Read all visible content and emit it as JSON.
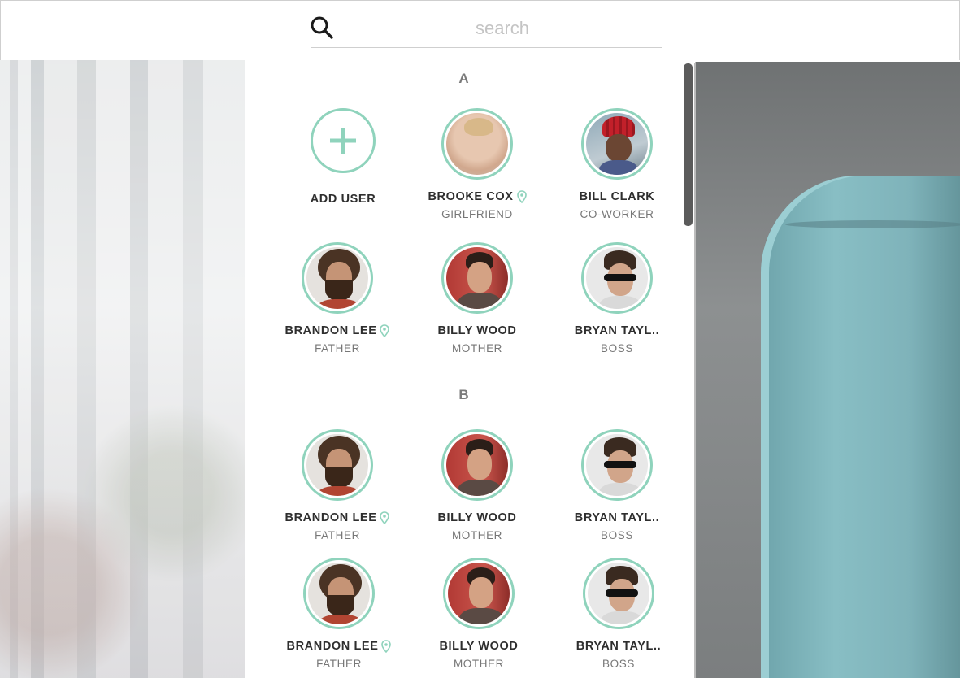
{
  "search": {
    "placeholder": "search"
  },
  "sections": [
    {
      "letter": "A"
    },
    {
      "letter": "B"
    }
  ],
  "add_user": {
    "label": "ADD USER"
  },
  "contacts": {
    "a1": {
      "name": "BROOKE COX",
      "relation": "GIRLFRIEND",
      "has_location": true,
      "avatar": "brooke"
    },
    "a2": {
      "name": "BILL CLARK",
      "relation": "CO-WORKER",
      "has_location": false,
      "avatar": "bill"
    },
    "a3": {
      "name": "BRANDON LEE",
      "relation": "FATHER",
      "has_location": true,
      "avatar": "brandon"
    },
    "a4": {
      "name": "BILLY WOOD",
      "relation": "MOTHER",
      "has_location": false,
      "avatar": "billy"
    },
    "a5": {
      "name": "BRYAN TAYL..",
      "relation": "BOSS",
      "has_location": false,
      "avatar": "bryan"
    },
    "b1": {
      "name": "BRANDON LEE",
      "relation": "FATHER",
      "has_location": true,
      "avatar": "brandon"
    },
    "b2": {
      "name": "BILLY WOOD",
      "relation": "MOTHER",
      "has_location": false,
      "avatar": "billy"
    },
    "b3": {
      "name": "BRYAN TAYL..",
      "relation": "BOSS",
      "has_location": false,
      "avatar": "bryan"
    },
    "b4": {
      "name": "BRANDON LEE",
      "relation": "FATHER",
      "has_location": true,
      "avatar": "brandon"
    },
    "b5": {
      "name": "BILLY WOOD",
      "relation": "MOTHER",
      "has_location": false,
      "avatar": "billy"
    },
    "b6": {
      "name": "BRYAN TAYL..",
      "relation": "BOSS",
      "has_location": false,
      "avatar": "bryan"
    }
  },
  "colors": {
    "accent": "#8fd3bc",
    "name_text": "#2e2e2e",
    "relation_text": "#777777",
    "section_letter": "#7a7a7a"
  },
  "icons": {
    "search": "search-icon",
    "add": "plus-icon",
    "location": "location-pin-icon"
  }
}
